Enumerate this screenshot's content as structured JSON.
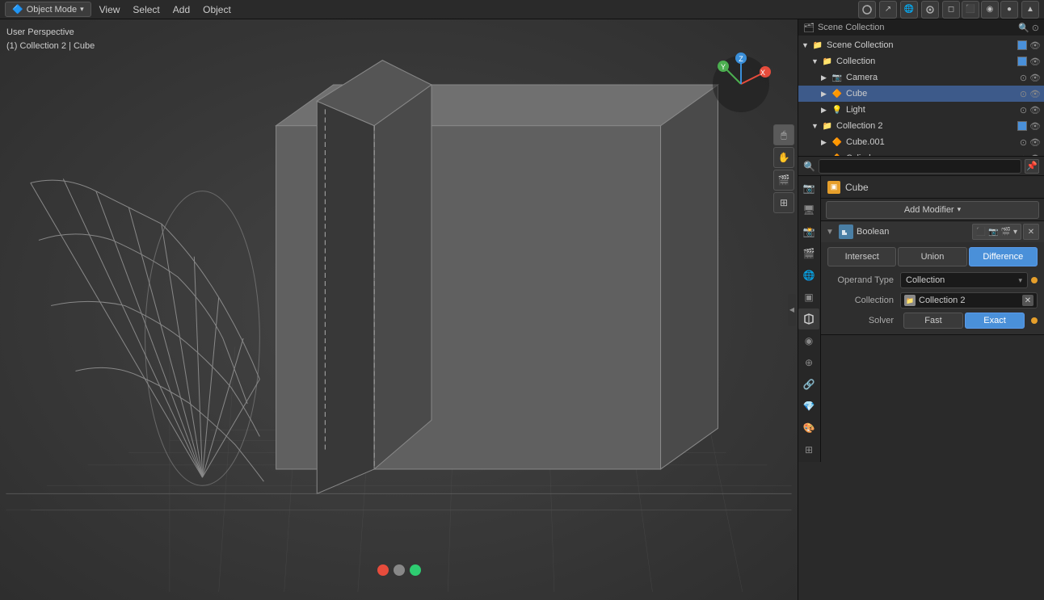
{
  "topbar": {
    "mode_label": "Object Mode",
    "menu_items": [
      "View",
      "Select",
      "Add",
      "Object"
    ]
  },
  "viewport": {
    "info_line1": "User Perspective",
    "info_line2": "(1) Collection 2 | Cube",
    "header_icons": [
      "🌐",
      "↗",
      "🌐",
      "☐",
      "⚫"
    ],
    "gizmo": {
      "x_label": "X",
      "y_label": "Y",
      "z_label": "Z"
    },
    "tool_icons": [
      "🔍",
      "✋",
      "🎬",
      "⊞"
    ],
    "color_dots": [
      "#e74c3c",
      "#3498db",
      "#2ecc71"
    ]
  },
  "outliner": {
    "title": "Scene Collection",
    "items": [
      {
        "indent": 0,
        "label": "Scene Collection",
        "arrow": "▼",
        "icon": "📁",
        "icon_color": "#888",
        "has_checkbox": true,
        "checked": true,
        "visible": true
      },
      {
        "indent": 1,
        "label": "Collection",
        "arrow": "▼",
        "icon": "📁",
        "icon_color": "#888",
        "has_checkbox": true,
        "checked": true,
        "visible": true
      },
      {
        "indent": 2,
        "label": "Camera",
        "arrow": "▶",
        "icon": "📷",
        "icon_color": "#e69f2b",
        "has_checkbox": false,
        "checked": false,
        "visible": true
      },
      {
        "indent": 2,
        "label": "Cube",
        "arrow": "▶",
        "icon": "🔶",
        "icon_color": "#e69f2b",
        "has_checkbox": false,
        "checked": false,
        "visible": true,
        "selected": true
      },
      {
        "indent": 2,
        "label": "Light",
        "arrow": "▶",
        "icon": "💡",
        "icon_color": "#e69f2b",
        "has_checkbox": false,
        "checked": false,
        "visible": true
      },
      {
        "indent": 1,
        "label": "Collection 2",
        "arrow": "▼",
        "icon": "📁",
        "icon_color": "#888",
        "has_checkbox": true,
        "checked": true,
        "visible": true
      },
      {
        "indent": 2,
        "label": "Cube.001",
        "arrow": "▶",
        "icon": "🔶",
        "icon_color": "#e69f2b",
        "has_checkbox": false,
        "checked": false,
        "visible": true
      },
      {
        "indent": 2,
        "label": "Cylinder",
        "arrow": "▶",
        "icon": "🔶",
        "icon_color": "#e69f2b",
        "has_checkbox": false,
        "checked": false,
        "visible": true
      }
    ]
  },
  "properties": {
    "search_placeholder": "",
    "object_name": "Cube",
    "object_icon": "▣",
    "add_modifier_label": "Add Modifier",
    "modifier": {
      "name": "Boolean",
      "type_icon": "⧖",
      "actions": [
        "realtime",
        "render",
        "camera",
        "down",
        "x"
      ],
      "operation_buttons": [
        {
          "label": "Intersect",
          "active": false
        },
        {
          "label": "Union",
          "active": false
        },
        {
          "label": "Difference",
          "active": true
        }
      ],
      "operand_type_label": "Operand Type",
      "operand_type_value": "Collection",
      "collection_label": "Collection",
      "collection_value": "Collection 2",
      "solver_label": "Solver",
      "solver_buttons": [
        {
          "label": "Fast",
          "active": false
        },
        {
          "label": "Exact",
          "active": true
        }
      ]
    },
    "tabs": [
      {
        "icon": "📷",
        "name": "render",
        "active": false
      },
      {
        "icon": "🖥",
        "name": "output",
        "active": false
      },
      {
        "icon": "📸",
        "name": "view-layer",
        "active": false
      },
      {
        "icon": "🎬",
        "name": "scene",
        "active": false
      },
      {
        "icon": "🌐",
        "name": "world",
        "active": false
      },
      {
        "icon": "▣",
        "name": "object",
        "active": false
      },
      {
        "icon": "⬡",
        "name": "modifiers",
        "active": true
      },
      {
        "icon": "◉",
        "name": "particles",
        "active": false
      },
      {
        "icon": "⊕",
        "name": "physics",
        "active": false
      },
      {
        "icon": "🔗",
        "name": "constraints",
        "active": false
      },
      {
        "icon": "💎",
        "name": "data",
        "active": false
      },
      {
        "icon": "🎨",
        "name": "material",
        "active": false
      },
      {
        "icon": "⊞",
        "name": "shaderfx",
        "active": false
      }
    ]
  }
}
